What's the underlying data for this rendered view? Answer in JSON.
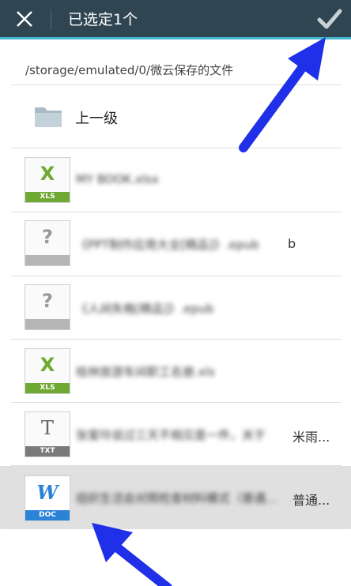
{
  "header": {
    "title": "已选定1个",
    "close_icon": "close-icon",
    "confirm_icon": "check-icon"
  },
  "path": "/storage/emulated/0/微云保存的文件",
  "up_label": "上一级",
  "files": [
    {
      "name": "MY BOOK.xlsx",
      "glyph": "X",
      "band": "XLS",
      "glyph_color": "#6fa832",
      "band_color": "#6fa832",
      "tail": ""
    },
    {
      "name": "《PPT制作应用大全[精品]》.epub",
      "glyph": "?",
      "band": "",
      "glyph_color": "#9a9a9a",
      "band_color": "#b5b5b5",
      "tail": "b"
    },
    {
      "name": "《人间失格[精品]》.epub",
      "glyph": "?",
      "band": "",
      "glyph_color": "#9a9a9a",
      "band_color": "#b5b5b5",
      "tail": ""
    },
    {
      "name": "桂林旅游车间职工名册.xls",
      "glyph": "X",
      "band": "XLS",
      "glyph_color": "#6fa832",
      "band_color": "#6fa832",
      "tail": ""
    },
    {
      "name": "张爱玲说过三天不相见是一件，关于",
      "glyph": "T",
      "band": "TXT",
      "glyph_color": "#666666",
      "band_color": "#7a7a7a",
      "tail": "米雨..."
    },
    {
      "name": "组织生活会对照检查材料模式（普通...",
      "glyph": "W",
      "band": "DOC",
      "glyph_color": "#2a83d6",
      "band_color": "#2a83d6",
      "tail": "普通..."
    }
  ]
}
